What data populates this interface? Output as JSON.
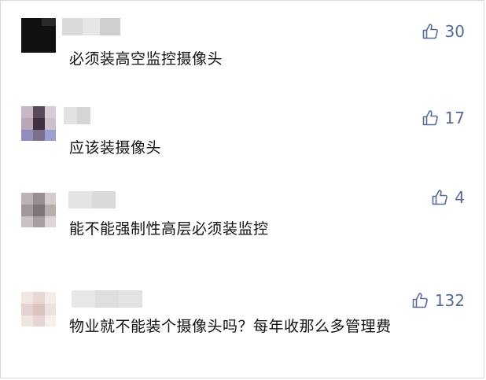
{
  "comments": [
    {
      "text": "必须装高空监控摄像头",
      "likes": "30",
      "avatar_color": "#141414",
      "like_icon": "thumbs-up-outline"
    },
    {
      "text": "应该装摄像头",
      "likes": "17",
      "avatar_color": "#a98fa8",
      "like_icon": "thumbs-up-outline"
    },
    {
      "text": "能不能强制性高层必须装监控",
      "likes": "4",
      "avatar_color": "#a9a0a0",
      "like_icon": "thumbs-up-outline"
    },
    {
      "text": "物业就不能装个摄像头吗？每年收那么多管理费",
      "likes": "132",
      "avatar_color": "#ead9d6",
      "like_icon": "thumbs-up-outline"
    }
  ],
  "colors": {
    "text": "#111111",
    "like_accent": "#576b95",
    "background": "#ffffff"
  }
}
